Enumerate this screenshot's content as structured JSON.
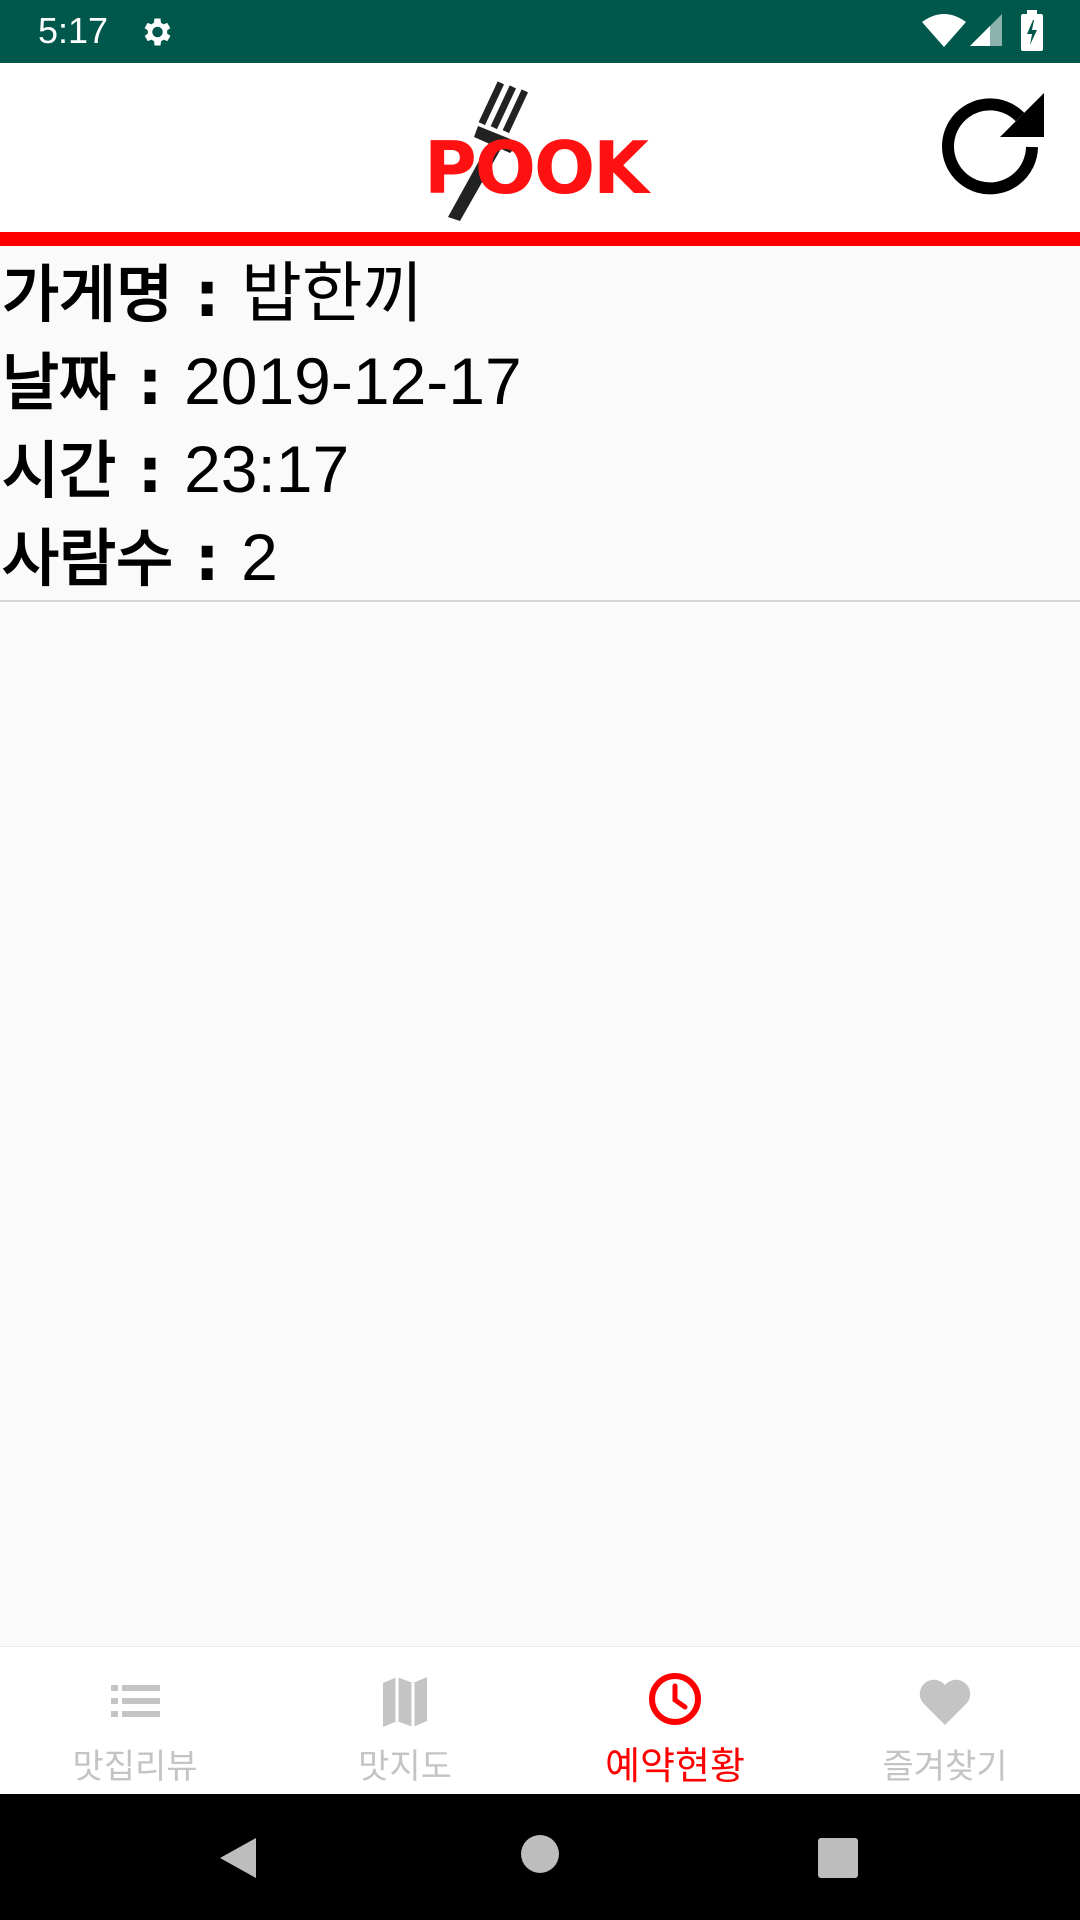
{
  "status_bar": {
    "time": "5:17",
    "icons": [
      "gear-icon",
      "wifi-icon",
      "signal-icon",
      "battery-icon"
    ],
    "background": "#00574b"
  },
  "app_bar": {
    "logo_text": "POOK",
    "logo_color": "#ff1111",
    "refresh_icon": "refresh-icon",
    "accent_rule_color": "#ff0000"
  },
  "reservation": {
    "store_label": "가게명",
    "store_value": "밥한끼",
    "date_label": "날짜",
    "date_value": "2019-12-17",
    "time_label": "시간",
    "time_value": "23:17",
    "people_label": "사람수",
    "people_value": "2",
    "separator": " : "
  },
  "bottom_nav": {
    "active_color": "#ff0000",
    "inactive_color": "#c4c4c4",
    "items": [
      {
        "label": "맛집리뷰",
        "icon": "list-icon",
        "active": false
      },
      {
        "label": "맛지도",
        "icon": "map-icon",
        "active": false
      },
      {
        "label": "예약현황",
        "icon": "clock-icon",
        "active": true
      },
      {
        "label": "즐겨찾기",
        "icon": "heart-icon",
        "active": false
      }
    ]
  },
  "system_nav": {
    "icons": [
      "back-icon",
      "home-icon",
      "recents-icon"
    ]
  }
}
